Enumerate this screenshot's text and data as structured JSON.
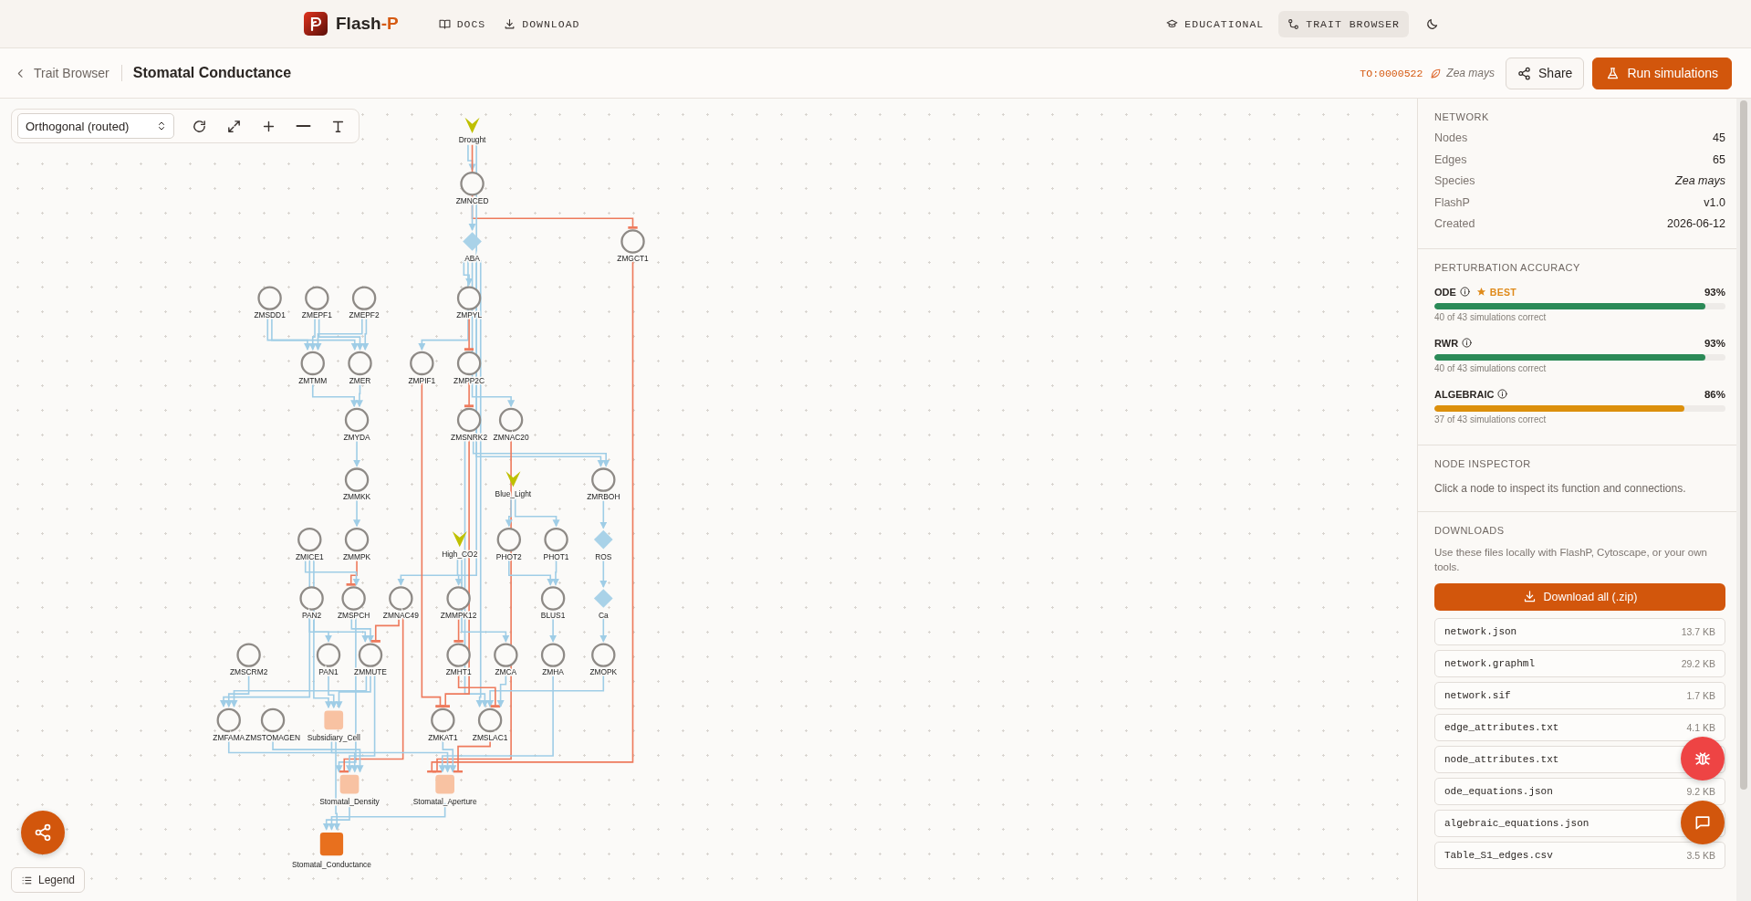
{
  "header": {
    "brand": {
      "name": "Flash",
      "accent": "-P"
    },
    "nav": [
      {
        "label": "DOCS"
      },
      {
        "label": "DOWNLOAD"
      }
    ],
    "tabs": [
      {
        "label": "EDUCATIONAL",
        "selected": false
      },
      {
        "label": "TRAIT BROWSER",
        "selected": true
      }
    ]
  },
  "breadcrumb": {
    "back": "Trait Browser",
    "title": "Stomatal Conductance",
    "term": "TO:0000522",
    "species": "Zea mays"
  },
  "actions": [
    {
      "label": "Share",
      "kind": "secondary"
    },
    {
      "label": "Run simulations",
      "kind": "primary"
    }
  ],
  "toolbar": {
    "layout": "Orthogonal (routed)"
  },
  "graph": {
    "nodes": [
      {
        "label": "Drought",
        "kind": "input"
      },
      {
        "label": "ZMNCED",
        "kind": "gene"
      },
      {
        "label": "ABA",
        "kind": "signal"
      },
      {
        "label": "ZMGCT1",
        "kind": "gene"
      },
      {
        "label": "ZMSDD1",
        "kind": "gene"
      },
      {
        "label": "ZMEPF1",
        "kind": "gene"
      },
      {
        "label": "ZMEPF2",
        "kind": "gene"
      },
      {
        "label": "ZMPYL",
        "kind": "gene"
      },
      {
        "label": "ZMTMM",
        "kind": "gene"
      },
      {
        "label": "ZMER",
        "kind": "gene"
      },
      {
        "label": "ZMPIF1",
        "kind": "gene"
      },
      {
        "label": "ZMPP2C",
        "kind": "gene"
      },
      {
        "label": "ZMYDA",
        "kind": "gene"
      },
      {
        "label": "ZMSNRK2",
        "kind": "gene"
      },
      {
        "label": "ZMNAC20",
        "kind": "gene"
      },
      {
        "label": "ZMMKK",
        "kind": "gene"
      },
      {
        "label": "Blue_Light",
        "kind": "input"
      },
      {
        "label": "ZMRBOH",
        "kind": "gene"
      },
      {
        "label": "ZMICE1",
        "kind": "gene"
      },
      {
        "label": "ZMMPK",
        "kind": "gene"
      },
      {
        "label": "High_CO2",
        "kind": "input"
      },
      {
        "label": "PHOT2",
        "kind": "gene"
      },
      {
        "label": "PHOT1",
        "kind": "gene"
      },
      {
        "label": "ROS",
        "kind": "signal"
      },
      {
        "label": "PAN2",
        "kind": "gene"
      },
      {
        "label": "ZMSPCH",
        "kind": "gene"
      },
      {
        "label": "ZMNAC49",
        "kind": "gene"
      },
      {
        "label": "ZMMPK12",
        "kind": "gene"
      },
      {
        "label": "BLUS1",
        "kind": "gene"
      },
      {
        "label": "Ca",
        "kind": "signal"
      },
      {
        "label": "ZMSCRM2",
        "kind": "gene"
      },
      {
        "label": "PAN1",
        "kind": "gene"
      },
      {
        "label": "ZMMUTE",
        "kind": "gene"
      },
      {
        "label": "ZMHT1",
        "kind": "gene"
      },
      {
        "label": "ZMCA",
        "kind": "gene"
      },
      {
        "label": "ZMHA",
        "kind": "gene"
      },
      {
        "label": "ZMOPK",
        "kind": "gene"
      },
      {
        "label": "ZMFAMA",
        "kind": "gene"
      },
      {
        "label": "ZMSTOMAGEN",
        "kind": "gene"
      },
      {
        "label": "Subsidiary_Cell",
        "kind": "phenotype"
      },
      {
        "label": "ZMKAT1",
        "kind": "gene"
      },
      {
        "label": "ZMSLAC1",
        "kind": "gene"
      },
      {
        "label": "Stomatal_Density",
        "kind": "phenotype"
      },
      {
        "label": "Stomatal_Aperture",
        "kind": "phenotype"
      },
      {
        "label": "Stomatal_Conductance",
        "kind": "trait"
      }
    ],
    "edges": [
      {
        "kind": "activation"
      },
      {
        "kind": "inhibition"
      },
      {
        "kind": "activation"
      },
      {
        "kind": "activation"
      },
      {
        "kind": "activation"
      },
      {
        "kind": "activation"
      },
      {
        "kind": "activation"
      },
      {
        "kind": "activation"
      },
      {
        "kind": "activation"
      },
      {
        "kind": "inhibition"
      },
      {
        "kind": "activation"
      },
      {
        "kind": "activation"
      },
      {
        "kind": "activation"
      },
      {
        "kind": "activation"
      },
      {
        "kind": "activation"
      },
      {
        "kind": "activation"
      },
      {
        "kind": "inhibition"
      },
      {
        "kind": "inhibition"
      },
      {
        "kind": "activation"
      },
      {
        "kind": "activation"
      },
      {
        "kind": "activation"
      },
      {
        "kind": "activation"
      },
      {
        "kind": "inhibition"
      },
      {
        "kind": "inhibition"
      },
      {
        "kind": "activation"
      },
      {
        "kind": "inhibition"
      },
      {
        "kind": "activation"
      },
      {
        "kind": "inhibition"
      },
      {
        "kind": "activation"
      },
      {
        "kind": "activation"
      },
      {
        "kind": "activation"
      },
      {
        "kind": "activation"
      },
      {
        "kind": "activation"
      },
      {
        "kind": "activation"
      },
      {
        "kind": "activation"
      },
      {
        "kind": "activation"
      },
      {
        "kind": "activation"
      },
      {
        "kind": "activation"
      },
      {
        "kind": "activation"
      },
      {
        "kind": "activation"
      },
      {
        "kind": "inhibition"
      },
      {
        "kind": "inhibition"
      },
      {
        "kind": "activation"
      },
      {
        "kind": "activation"
      },
      {
        "kind": "activation"
      },
      {
        "kind": "activation"
      },
      {
        "kind": "activation"
      },
      {
        "kind": "activation"
      },
      {
        "kind": "activation"
      },
      {
        "kind": "activation"
      },
      {
        "kind": "activation"
      },
      {
        "kind": "inhibition"
      },
      {
        "kind": "inhibition"
      },
      {
        "kind": "activation"
      },
      {
        "kind": "activation"
      },
      {
        "kind": "activation"
      },
      {
        "kind": "activation"
      },
      {
        "kind": "activation"
      },
      {
        "kind": "activation"
      },
      {
        "kind": "activation"
      },
      {
        "kind": "activation"
      },
      {
        "kind": "inhibition"
      },
      {
        "kind": "activation"
      },
      {
        "kind": "activation"
      },
      {
        "kind": "activation"
      }
    ]
  },
  "legend": "Legend",
  "panel": {
    "network": {
      "title": "NETWORK",
      "rows": [
        {
          "label": "Nodes",
          "value": "45",
          "italic": false
        },
        {
          "label": "Edges",
          "value": "65",
          "italic": false
        },
        {
          "label": "Species",
          "value": "Zea mays",
          "italic": true
        },
        {
          "label": "FlashP",
          "value": "v1.0",
          "italic": false
        },
        {
          "label": "Created",
          "value": "2026-06-12",
          "italic": false
        }
      ]
    },
    "accuracy": {
      "title": "PERTURBATION ACCURACY",
      "methods": [
        {
          "name": "ODE",
          "badge": "BEST",
          "value": "93%",
          "level": 0.93,
          "color": "#2b8a57",
          "caption": "40 of 43 simulations correct"
        },
        {
          "name": "RWR",
          "value": "93%",
          "level": 0.93,
          "color": "#2b8a57",
          "caption": "40 of 43 simulations correct"
        },
        {
          "name": "ALGEBRAIC",
          "value": "86%",
          "level": 0.86,
          "color": "#dc900c",
          "caption": "37 of 43 simulations correct"
        }
      ]
    },
    "inspector": {
      "title": "NODE INSPECTOR",
      "hint": "Click a node to inspect its function and connections."
    },
    "downloads": {
      "title": "DOWNLOADS",
      "text": "Use these files locally with FlashP, Cytoscape, or your own tools.",
      "button": "Download all (.zip)",
      "files": [
        {
          "name": "network.json",
          "size": "13.7 KB"
        },
        {
          "name": "network.graphml",
          "size": "29.2 KB"
        },
        {
          "name": "network.sif",
          "size": "1.7 KB"
        },
        {
          "name": "edge_attributes.txt",
          "size": "4.1 KB"
        },
        {
          "name": "node_attributes.txt"
        },
        {
          "name": "ode_equations.json",
          "size": "9.2 KB"
        },
        {
          "name": "algebraic_equations.json"
        },
        {
          "name": "Table_S1_edges.csv",
          "size": "3.5 KB"
        }
      ]
    }
  }
}
